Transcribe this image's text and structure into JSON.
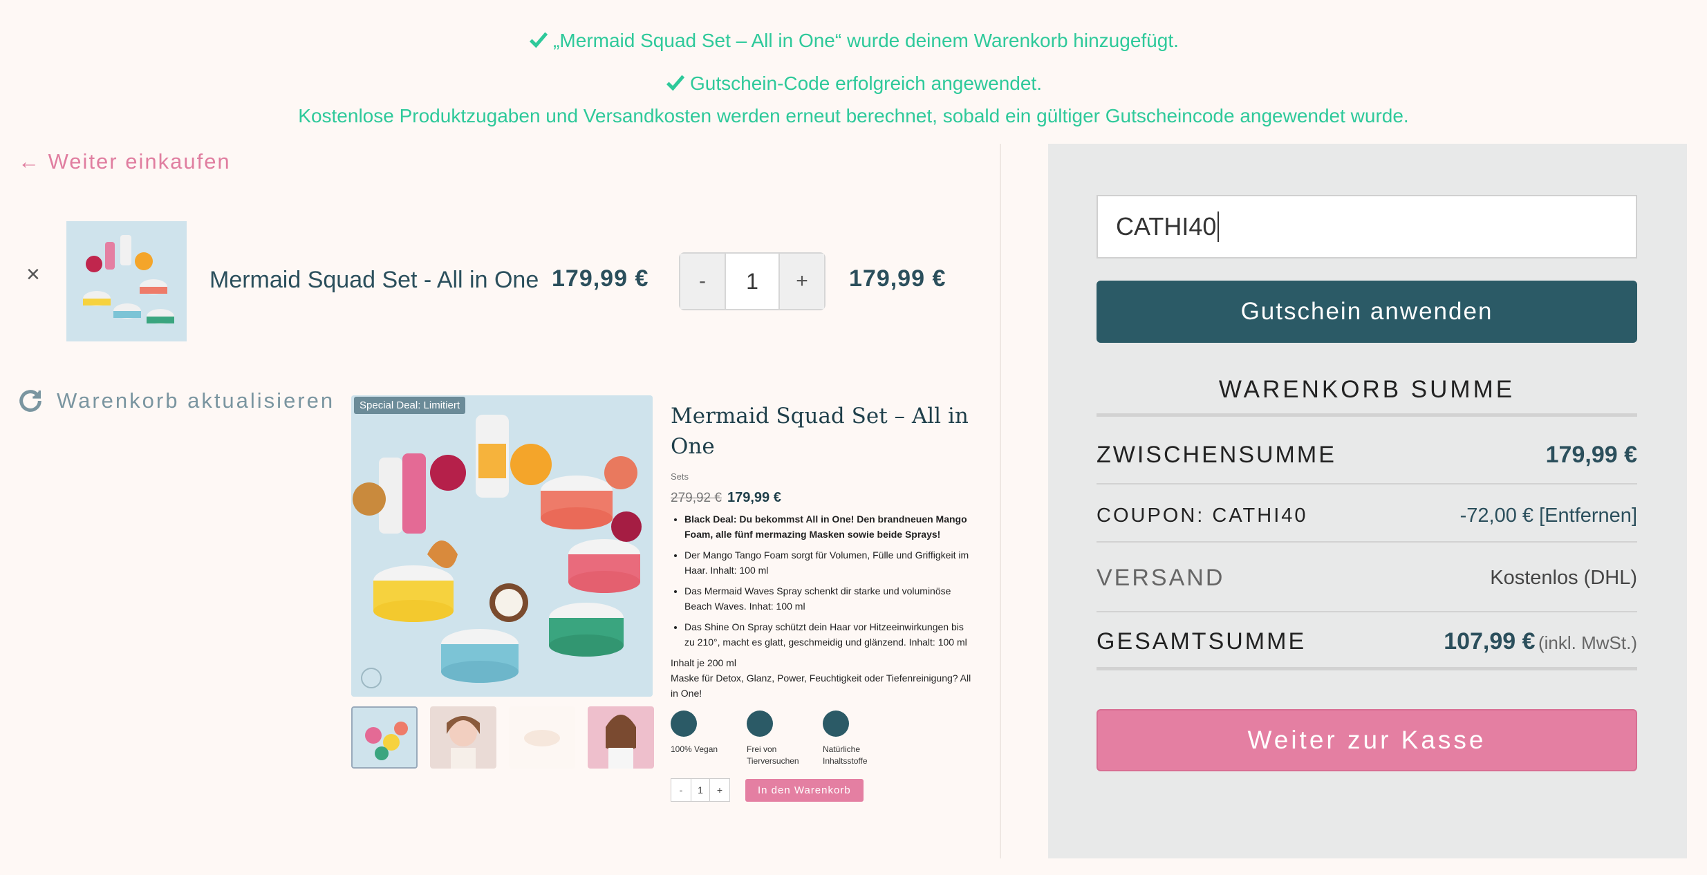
{
  "notices": {
    "added": "„Mermaid Squad Set – All in One“ wurde deinem Warenkorb hinzugefügt.",
    "coupon": "Gutschein-Code erfolgreich angewendet.",
    "recalc": "Kostenlose Produktzugaben und Versandkosten werden erneut berechnet, sobald ein gültiger Gutscheincode angewendet wurde."
  },
  "nav": {
    "continue_shopping": "← Weiter einkaufen"
  },
  "cart": {
    "remove": "×",
    "item_name": "Mermaid Squad Set - All in One",
    "unit_price": "179,99 €",
    "qty_minus": "-",
    "qty": "1",
    "qty_plus": "+",
    "line_total": "179,99 €",
    "update_label": "Warenkorb aktualisieren"
  },
  "product": {
    "badge": "Special Deal: Limitiert",
    "title": "Mermaid Squad Set – All in One",
    "category": "Sets",
    "old_price": "279,92 €",
    "new_price": "179,99 €",
    "bullets": [
      "Black Deal: Du bekommst All in One! Den brandneuen Mango Foam, alle fünf mermazing Masken sowie beide Sprays!",
      "Der Mango Tango Foam sorgt für Volumen, Fülle und Griffigkeit im Haar. Inhalt: 100 ml",
      "Das Mermaid Waves Spray schenkt dir starke und voluminöse Beach Waves. Inhat: 100 ml",
      "Das Shine On Spray schützt dein Haar vor Hitzeeinwirkungen bis zu 210°, macht es glatt, geschmeidig und glänzend. Inhalt: 100 ml"
    ],
    "note_line1": "Inhalt je 200 ml",
    "note_line2": "Maske für Detox, Glanz, Power, Feuchtigkeit oder Tiefenreinigung? All in One!",
    "features": [
      "100% Vegan",
      "Frei von Tierversuchen",
      "Natürliche Inhaltsstoffe"
    ],
    "mini_minus": "-",
    "mini_qty": "1",
    "mini_plus": "+",
    "add_to_cart": "In den Warenkorb"
  },
  "summary": {
    "coupon_value": "CATHI40",
    "apply_button": "Gutschein anwenden",
    "title": "WARENKORB SUMME",
    "subtotal_label": "ZWISCHENSUMME",
    "subtotal_value": "179,99 €",
    "coupon_label": "COUPON: CATHI40",
    "coupon_discount": "-72,00 €",
    "coupon_remove": "[Entfernen]",
    "shipping_label": "VERSAND",
    "shipping_value": "Kostenlos (DHL)",
    "total_label": "GESAMTSUMME",
    "total_value": "107,99 €",
    "total_note": "(inkl. MwSt.)",
    "checkout_button": "Weiter zur Kasse"
  },
  "colors": {
    "success": "#2ec99a",
    "accent_pink": "#e47fa2",
    "primary_teal": "#2b5a66",
    "background": "#fef8f5"
  }
}
